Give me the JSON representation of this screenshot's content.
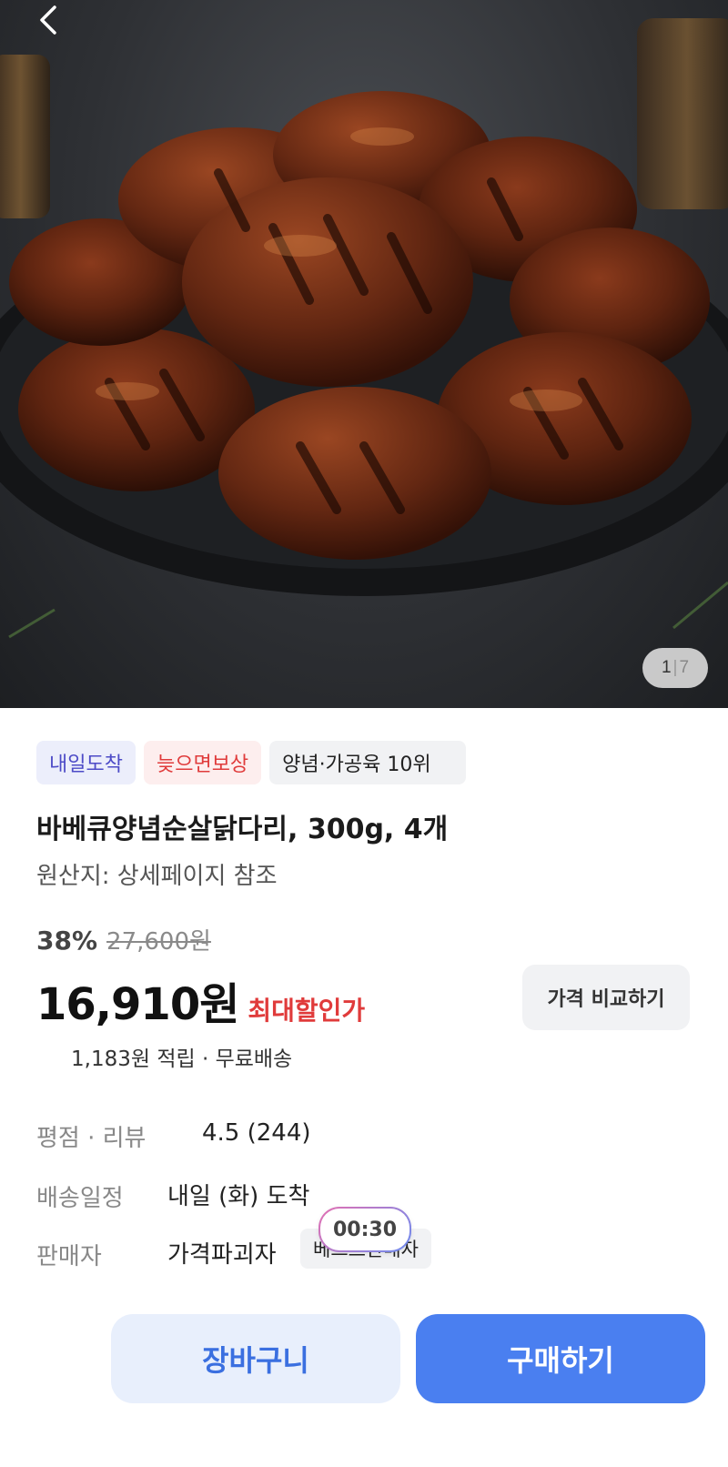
{
  "gallery": {
    "current_index": "1",
    "separator": "|",
    "total": "7",
    "image_alt": "grilled bbq glazed boneless chicken thighs on black plate"
  },
  "badges": {
    "arrival": "내일도착",
    "late_comp": "늦으면보상",
    "rank": "양념·가공육 10위"
  },
  "product": {
    "title": "바베큐양념순살닭다리, 300g, 4개",
    "origin": "원산지: 상세페이지 참조"
  },
  "pricing": {
    "discount_rate": "38%",
    "original_price": "27,600원",
    "price": "16,910원",
    "best_label": "최대할인가",
    "compare_label": "가격 비교하기",
    "points_shipping": "1,183원 적립 · 무료배송"
  },
  "info": {
    "rating_label": "평점 · 리뷰",
    "rating_value": "4.5 (244)",
    "delivery_label": "배송일정",
    "delivery_value": "내일 (화) 도착",
    "seller_label": "판매자",
    "seller_value": "가격파괴자",
    "seller_badge": "베스트판매자"
  },
  "timer": "00:30",
  "actions": {
    "cart": "장바구니",
    "buy": "구매하기"
  },
  "colors": {
    "accent_blue": "#4a7ff0",
    "sale_red": "#e03b3b",
    "badge_purple": "#4d4bc7"
  }
}
